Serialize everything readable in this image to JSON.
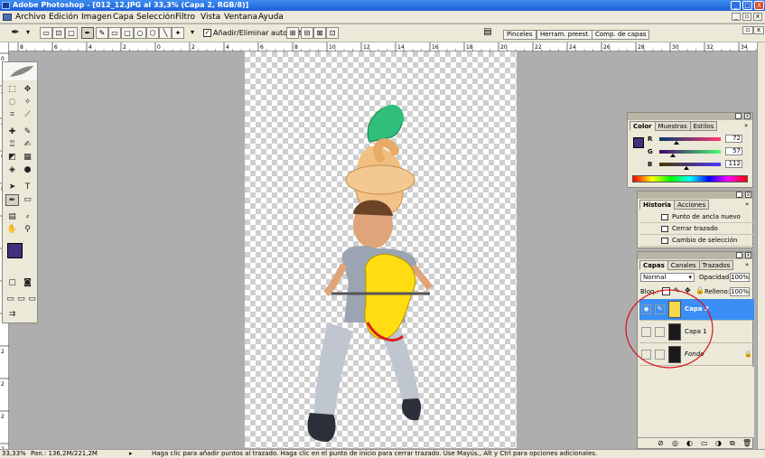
{
  "window": {
    "title": "Adobe Photoshop - [012_12.JPG al 33,3% (Capa 2, RGB/8)]",
    "controls": [
      "_",
      "□",
      "X"
    ]
  },
  "menu": [
    "Archivo",
    "Edición",
    "Imagen",
    "Capa",
    "Selección",
    "Filtro",
    "Vista",
    "Ventana",
    "Ayuda"
  ],
  "options_bar": {
    "auto_add_delete_label": "Añadir/Eliminar automát.",
    "auto_add_delete_checked": true,
    "palette_tabs": [
      "Pinceles",
      "Herram. preest.",
      "Comp. de capas"
    ]
  },
  "ruler": {
    "h_ticks": [
      "8",
      "6",
      "4",
      "2",
      "0",
      "2",
      "4",
      "6",
      "8",
      "10",
      "12",
      "14",
      "16",
      "18",
      "20",
      "22",
      "24",
      "26",
      "28",
      "30",
      "32",
      "34"
    ],
    "v_ticks": [
      "0",
      "2",
      "4",
      "6",
      "8",
      "1",
      "1",
      "1",
      "1",
      "2",
      "2",
      "2",
      "2"
    ]
  },
  "color_panel": {
    "tabs": [
      "Color",
      "Muestras",
      "Estilos"
    ],
    "active_tab": "Color",
    "foreground": "#41307a",
    "r": "72",
    "g": "57",
    "b": "112",
    "r_label": "R",
    "g_label": "G",
    "b_label": "B"
  },
  "history_panel": {
    "tabs": [
      "Historia",
      "Acciones"
    ],
    "active_tab": "Historia",
    "items": [
      "Punto de ancla nuevo",
      "Cerrar trazado",
      "Cambio de selección"
    ]
  },
  "layers_panel": {
    "tabs": [
      "Capas",
      "Canales",
      "Trazados"
    ],
    "active_tab": "Capas",
    "blend_mode": "Normal",
    "opacity_label": "Opacidad:",
    "opacity": "100%",
    "lock_label": "Bloq.:",
    "fill_label": "Relleno:",
    "fill": "100%",
    "layers": [
      {
        "name": "Capa 2",
        "active": true,
        "visible": true
      },
      {
        "name": "Capa 1",
        "active": false,
        "visible": false
      },
      {
        "name": "Fondo",
        "active": false,
        "visible": false,
        "locked": true
      }
    ]
  },
  "status_bar": {
    "zoom": "33,33%",
    "doc_size": "Pan.: 136,2M/221,2M",
    "hint": "Haga clic para añadir puntos al trazado. Haga clic en el punto de inicio para cerrar trazado. Use Mayús., Alt y Ctrl para opciones adicionales."
  },
  "colors": {
    "accent_active_layer": "#3a8ef6",
    "annotation_circle": "#d8101a",
    "foreground_swatch": "#41307a"
  }
}
